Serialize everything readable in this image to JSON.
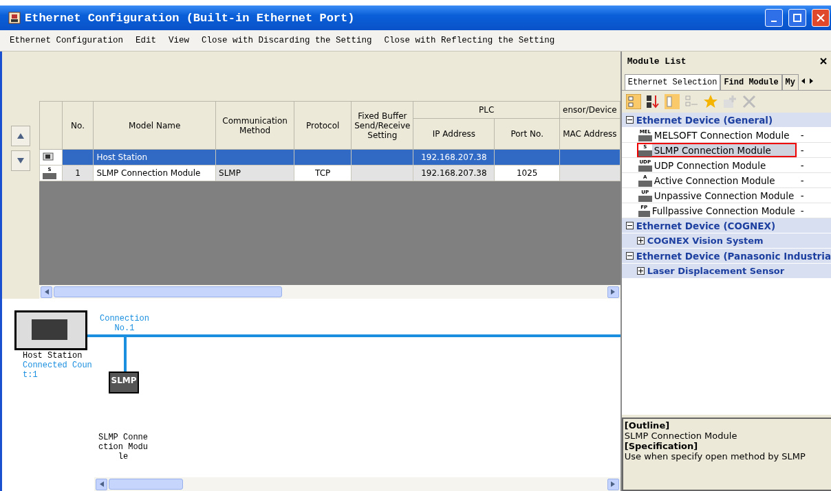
{
  "window": {
    "title": "Ethernet Configuration (Built-in Ethernet Port)"
  },
  "menu": [
    "Ethernet Configuration",
    "Edit",
    "View",
    "Close with Discarding the Setting",
    "Close with Reflecting the Setting"
  ],
  "table": {
    "group_headers": [
      "PLC",
      "ensor/Device"
    ],
    "columns": [
      "No.",
      "Model Name",
      "Communication Method",
      "Protocol",
      "Fixed Buffer Send/Receive Setting",
      "IP Address",
      "Port No.",
      "MAC Address"
    ],
    "rows": [
      {
        "kind": "host",
        "selected": true,
        "cells": [
          "",
          "Host Station",
          "",
          "",
          "",
          "192.168.207.38",
          "",
          ""
        ]
      },
      {
        "kind": "slmp",
        "icon_text": "S",
        "selected": false,
        "cells": [
          "1",
          "SLMP Connection Module",
          "SLMP",
          "TCP",
          "",
          "192.168.207.38",
          "1025",
          ""
        ]
      }
    ]
  },
  "diagram": {
    "host_label": "Host Station",
    "host_count": "Connected Count:1",
    "connection_label": "Connection No.1",
    "node_text": "SLMP",
    "node_label": "SLMP Connection Module"
  },
  "module_list": {
    "title": "Module List",
    "tabs": [
      {
        "label": "Ethernet Selection",
        "selected": true
      },
      {
        "label": "Find Module",
        "selected": false
      },
      {
        "label": "My",
        "selected": false
      }
    ],
    "tree": [
      {
        "label": "Ethernet Device (General)",
        "expanded": true,
        "children": [
          {
            "label": "MELSOFT Connection Module",
            "icon_text": "MEL",
            "value": "-",
            "selected": false
          },
          {
            "label": "SLMP Connection Module",
            "icon_text": "S",
            "value": "-",
            "selected": true
          },
          {
            "label": "UDP Connection Module",
            "icon_text": "UDP",
            "value": "-",
            "selected": false
          },
          {
            "label": "Active Connection Module",
            "icon_text": "A",
            "value": "-",
            "selected": false
          },
          {
            "label": "Unpassive Connection Module",
            "icon_text": "UP",
            "value": "-",
            "selected": false
          },
          {
            "label": "Fullpassive Connection Module",
            "icon_text": "FP",
            "value": "-",
            "selected": false
          }
        ]
      },
      {
        "label": "Ethernet Device (COGNEX)",
        "expanded": true,
        "children": [
          {
            "label": "COGNEX Vision System",
            "expanded": false
          }
        ]
      },
      {
        "label": "Ethernet Device (Panasonic Industria",
        "expanded": true,
        "children": [
          {
            "label": "Laser Displacement Sensor",
            "expanded": false
          }
        ]
      }
    ],
    "description": [
      {
        "kind": "heading",
        "text": "[Outline]"
      },
      {
        "kind": "body",
        "text": "SLMP Connection Module"
      },
      {
        "kind": "heading",
        "text": "[Specification]"
      },
      {
        "kind": "body",
        "text": "Use when specify open method by SLMP"
      }
    ]
  }
}
